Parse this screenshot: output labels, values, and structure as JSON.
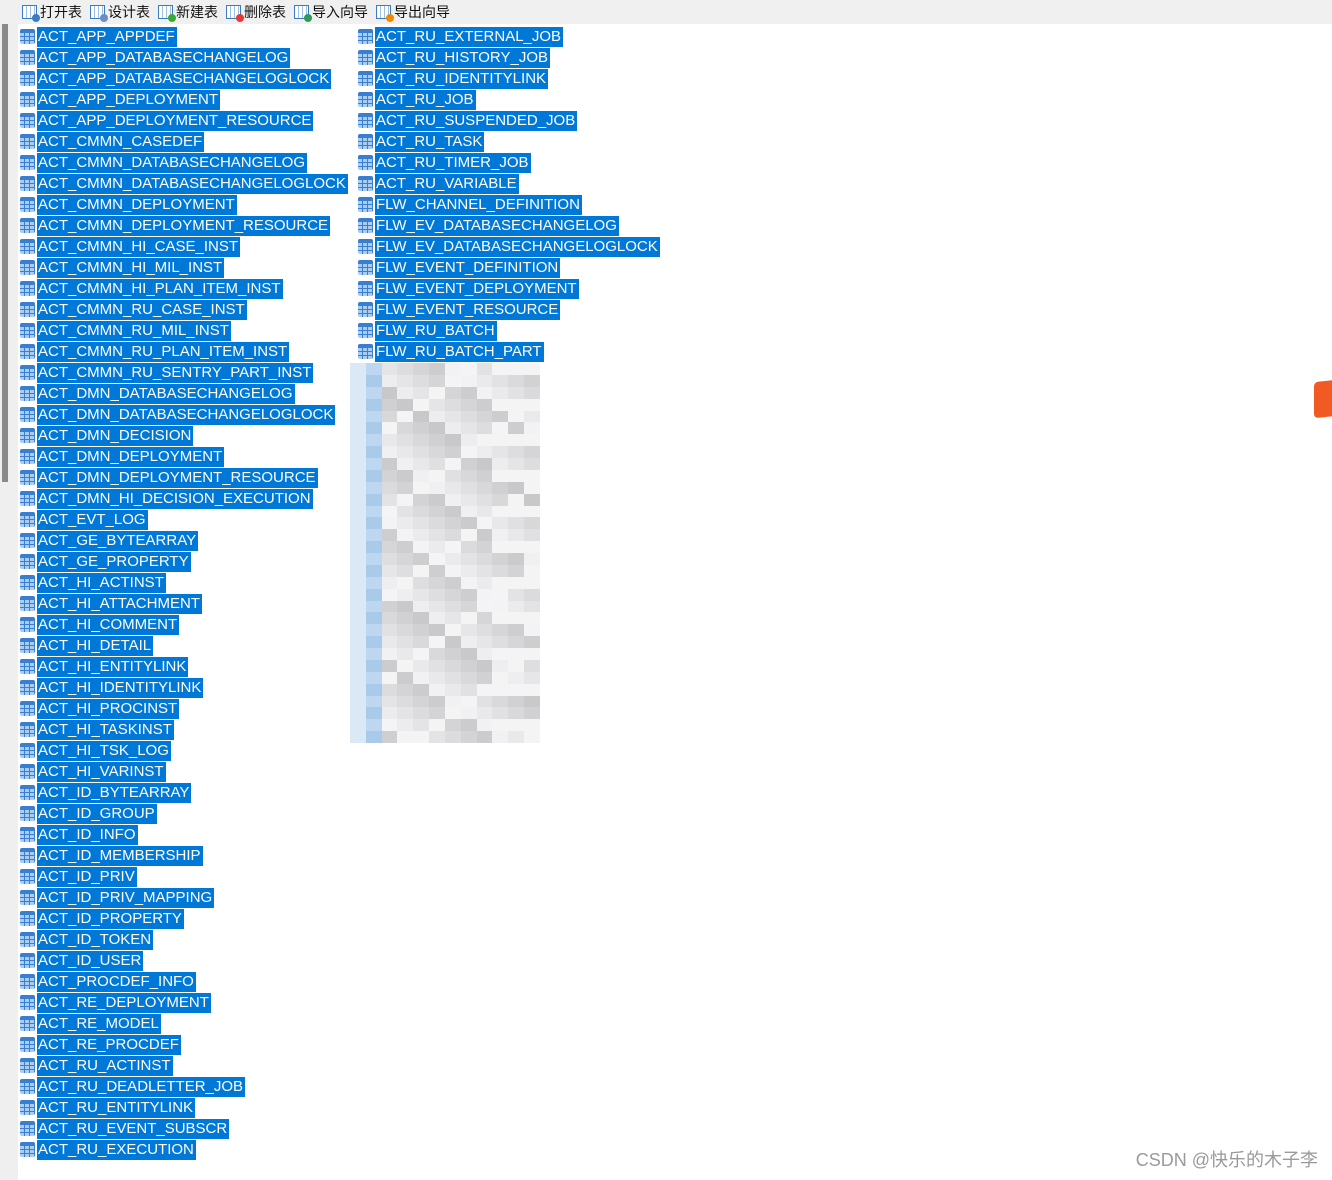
{
  "toolbar": {
    "items": [
      {
        "label": "打开表",
        "icon": "open-table-icon",
        "badge": "#3b7bc0"
      },
      {
        "label": "设计表",
        "icon": "design-table-icon",
        "badge": "#6a8fc0"
      },
      {
        "label": "新建表",
        "icon": "new-table-icon",
        "badge": "#3aaa35"
      },
      {
        "label": "删除表",
        "icon": "delete-table-icon",
        "badge": "#e53935"
      },
      {
        "label": "导入向导",
        "icon": "import-wizard-icon",
        "badge": "#2e9a5a"
      },
      {
        "label": "导出向导",
        "icon": "export-wizard-icon",
        "badge": "#f08a00"
      }
    ]
  },
  "tables_col1": [
    "ACT_APP_APPDEF",
    "ACT_APP_DATABASECHANGELOG",
    "ACT_APP_DATABASECHANGELOGLOCK",
    "ACT_APP_DEPLOYMENT",
    "ACT_APP_DEPLOYMENT_RESOURCE",
    "ACT_CMMN_CASEDEF",
    "ACT_CMMN_DATABASECHANGELOG",
    "ACT_CMMN_DATABASECHANGELOGLOCK",
    "ACT_CMMN_DEPLOYMENT",
    "ACT_CMMN_DEPLOYMENT_RESOURCE",
    "ACT_CMMN_HI_CASE_INST",
    "ACT_CMMN_HI_MIL_INST",
    "ACT_CMMN_HI_PLAN_ITEM_INST",
    "ACT_CMMN_RU_CASE_INST",
    "ACT_CMMN_RU_MIL_INST",
    "ACT_CMMN_RU_PLAN_ITEM_INST",
    "ACT_CMMN_RU_SENTRY_PART_INST",
    "ACT_DMN_DATABASECHANGELOG",
    "ACT_DMN_DATABASECHANGELOGLOCK",
    "ACT_DMN_DECISION",
    "ACT_DMN_DEPLOYMENT",
    "ACT_DMN_DEPLOYMENT_RESOURCE",
    "ACT_DMN_HI_DECISION_EXECUTION",
    "ACT_EVT_LOG",
    "ACT_GE_BYTEARRAY",
    "ACT_GE_PROPERTY",
    "ACT_HI_ACTINST",
    "ACT_HI_ATTACHMENT",
    "ACT_HI_COMMENT",
    "ACT_HI_DETAIL",
    "ACT_HI_ENTITYLINK",
    "ACT_HI_IDENTITYLINK",
    "ACT_HI_PROCINST",
    "ACT_HI_TASKINST",
    "ACT_HI_TSK_LOG",
    "ACT_HI_VARINST",
    "ACT_ID_BYTEARRAY",
    "ACT_ID_GROUP",
    "ACT_ID_INFO",
    "ACT_ID_MEMBERSHIP",
    "ACT_ID_PRIV",
    "ACT_ID_PRIV_MAPPING",
    "ACT_ID_PROPERTY",
    "ACT_ID_TOKEN",
    "ACT_ID_USER",
    "ACT_PROCDEF_INFO",
    "ACT_RE_DEPLOYMENT",
    "ACT_RE_MODEL",
    "ACT_RE_PROCDEF",
    "ACT_RU_ACTINST",
    "ACT_RU_DEADLETTER_JOB",
    "ACT_RU_ENTITYLINK",
    "ACT_RU_EVENT_SUBSCR",
    "ACT_RU_EXECUTION"
  ],
  "tables_col2": [
    "ACT_RU_EXTERNAL_JOB",
    "ACT_RU_HISTORY_JOB",
    "ACT_RU_IDENTITYLINK",
    "ACT_RU_JOB",
    "ACT_RU_SUSPENDED_JOB",
    "ACT_RU_TASK",
    "ACT_RU_TIMER_JOB",
    "ACT_RU_VARIABLE",
    "FLW_CHANNEL_DEFINITION",
    "FLW_EV_DATABASECHANGELOG",
    "FLW_EV_DATABASECHANGELOGLOCK",
    "FLW_EVENT_DEFINITION",
    "FLW_EVENT_DEPLOYMENT",
    "FLW_EVENT_RESOURCE",
    "FLW_RU_BATCH",
    "FLW_RU_BATCH_PART"
  ],
  "colors": {
    "selection": "#0078d7",
    "logo": "#f15a22"
  },
  "watermark": "CSDN @快乐的木子李"
}
